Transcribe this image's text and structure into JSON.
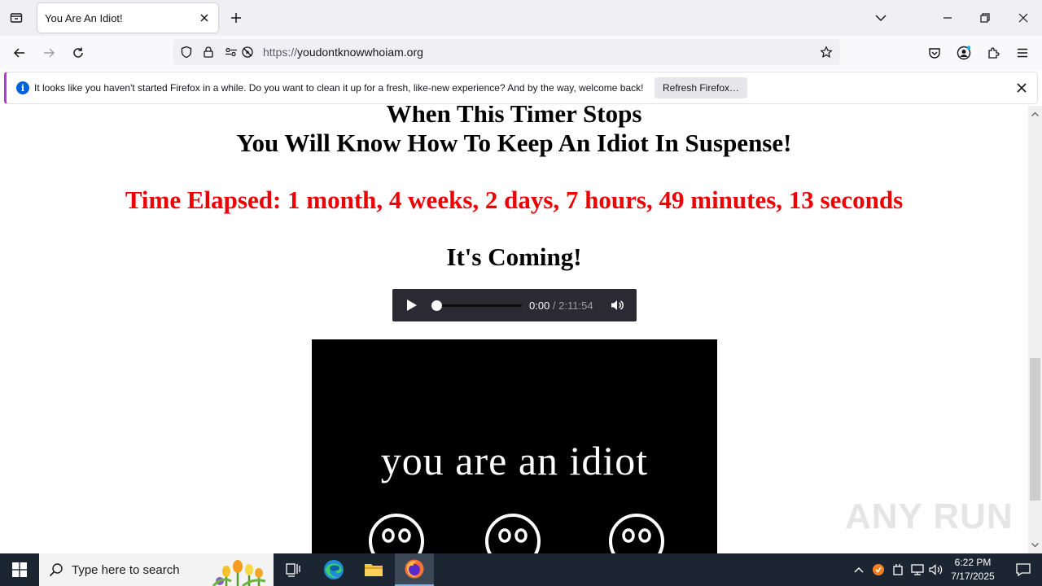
{
  "browser": {
    "tab": {
      "title": "You Are An Idiot!"
    },
    "url": {
      "protocol": "https://",
      "host": "youdontknowwhoiam.org"
    },
    "notification": {
      "text": "It looks like you haven't started Firefox in a while. Do you want to clean it up for a fresh, like-new experience? And by the way, welcome back!",
      "button_label": "Refresh Firefox…"
    }
  },
  "page": {
    "line1": "When This Timer Stops",
    "line2": "You Will Know How To Keep An Idiot In Suspense!",
    "timer": "Time Elapsed: 1 month, 4 weeks, 2 days, 7 hours, 49 minutes, 13 seconds",
    "coming": "It's Coming!",
    "audio": {
      "current": "0:00",
      "duration": " / 2:11:54",
      "progress": 0
    },
    "video_text": "you are an idiot"
  },
  "watermark": "ANY RUN",
  "taskbar": {
    "search_placeholder": "Type here to search",
    "time": "6:22 PM",
    "date": "7/17/2025"
  },
  "colors": {
    "timer": "#ee0000",
    "tabstrip": "#f0f0f4",
    "taskbar": "#1c2532",
    "accent": "#0060df"
  }
}
